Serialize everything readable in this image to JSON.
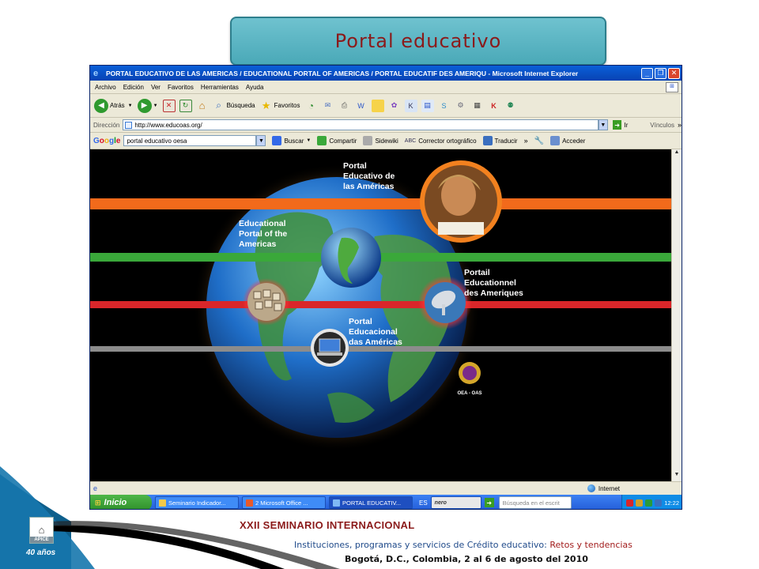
{
  "slide": {
    "title": "Portal educativo"
  },
  "browser": {
    "window_title": "PORTAL EDUCATIVO DE LAS AMERICAS / EDUCATIONAL PORTAL OF AMERICAS / PORTAL EDUCATIF DES AMERIQU - Microsoft Internet Explorer",
    "menu": [
      "Archivo",
      "Edición",
      "Ver",
      "Favoritos",
      "Herramientas",
      "Ayuda"
    ],
    "toolbar": {
      "back_label": "Atrás",
      "search_label": "Búsqueda",
      "favorites_label": "Favoritos"
    },
    "address": {
      "label": "Dirección",
      "url": "http://www.educoas.org/",
      "go_label": "Ir",
      "links_label": "Vínculos"
    },
    "google_bar": {
      "logo": "Google",
      "query": "portal educativo oesa",
      "search_label": "Buscar",
      "share_label": "Compartir",
      "sidewiki_label": "Sidewiki",
      "spell_label": "Corrector ortográfico",
      "translate_label": "Traducir",
      "signin_label": "Acceder"
    },
    "status": {
      "zone": "Internet"
    }
  },
  "page_content": {
    "es_title": [
      "Portal",
      "Educativo de",
      "las Américas"
    ],
    "en_title": [
      "Educational",
      "Portal of the",
      "Americas"
    ],
    "fr_title": [
      "Portail",
      "Educationnel",
      "des Ameriques"
    ],
    "pt_title": [
      "Portal",
      "Educacional",
      "das Américas"
    ],
    "oas_label": "OEA - OAS",
    "band_colors": [
      "#f26a1b",
      "#3aa83a",
      "#d9262a",
      "#8c8c8c"
    ]
  },
  "taskbar": {
    "start_label": "Inicio",
    "tasks": [
      "Seminario Indicador...",
      "2 Microsoft Office ...",
      "PORTAL EDUCATIV..."
    ],
    "language": "ES",
    "search_placeholder": "Búsqueda en el escrit",
    "time": "12:22"
  },
  "footer": {
    "logo_label": "APICE",
    "years": "40 años",
    "seminar": "XXII SEMINARIO INTERNACIONAL",
    "subtitle_main": "Instituciones, programas y servicios de Crédito educativo: ",
    "subtitle_accent": "Retos y tendencias",
    "place": "Bogotá, D.C., Colombia, 2 al 6 de agosto del 2010"
  }
}
